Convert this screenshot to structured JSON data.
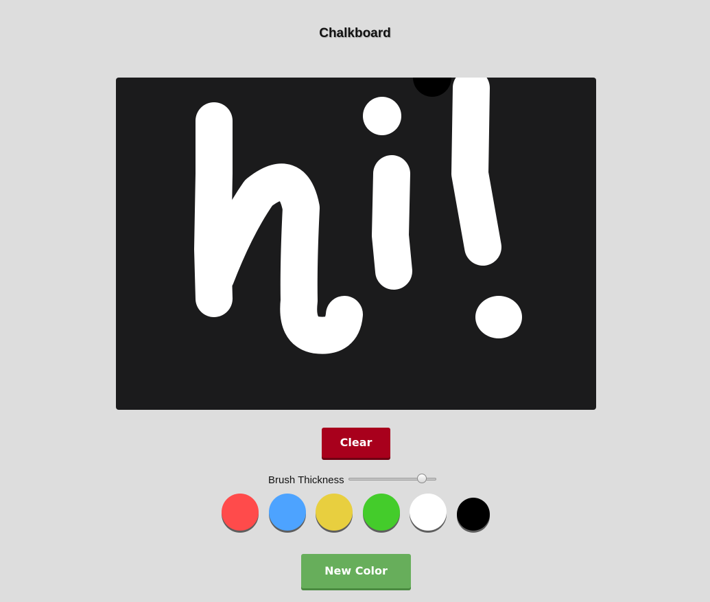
{
  "title": "Chalkboard",
  "board": {
    "background": "#1b1b1c",
    "stroke_color": "#ffffff",
    "drawing_text": "hi!"
  },
  "buttons": {
    "clear": "Clear",
    "new_color": "New Color",
    "clear_color": "#a8001c",
    "new_color_color": "#67ae5b"
  },
  "brush": {
    "label": "Brush Thickness",
    "value_fraction": 0.84
  },
  "palette": [
    {
      "name": "red",
      "color": "#ff4b4b"
    },
    {
      "name": "blue",
      "color": "#4da3ff"
    },
    {
      "name": "yellow",
      "color": "#e8cf3f"
    },
    {
      "name": "green",
      "color": "#44cc2b"
    },
    {
      "name": "white",
      "color": "#ffffff"
    },
    {
      "name": "black",
      "color": "#000000"
    }
  ]
}
